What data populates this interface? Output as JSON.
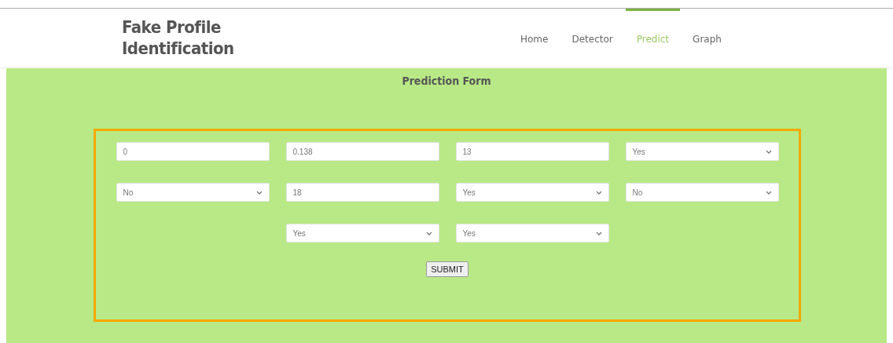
{
  "site_title": "Fake Profile Identification",
  "nav": [
    {
      "label": "Home",
      "selected": false
    },
    {
      "label": "Detector",
      "selected": false
    },
    {
      "label": "Predict",
      "selected": true
    },
    {
      "label": "Graph",
      "selected": false
    }
  ],
  "form": {
    "heading": "Prediction Form",
    "rows": [
      [
        {
          "kind": "input",
          "value": "0"
        },
        {
          "kind": "input",
          "value": "0.138"
        },
        {
          "kind": "input",
          "value": "13"
        },
        {
          "kind": "select",
          "value": "Yes"
        }
      ],
      [
        {
          "kind": "select",
          "value": "No"
        },
        {
          "kind": "input",
          "value": "18"
        },
        {
          "kind": "select",
          "value": "Yes"
        },
        {
          "kind": "select",
          "value": "No"
        }
      ],
      [
        "",
        {
          "kind": "select",
          "value": "Yes"
        },
        {
          "kind": "select",
          "value": "Yes"
        },
        ""
      ]
    ],
    "submit": "SUBMIT"
  }
}
